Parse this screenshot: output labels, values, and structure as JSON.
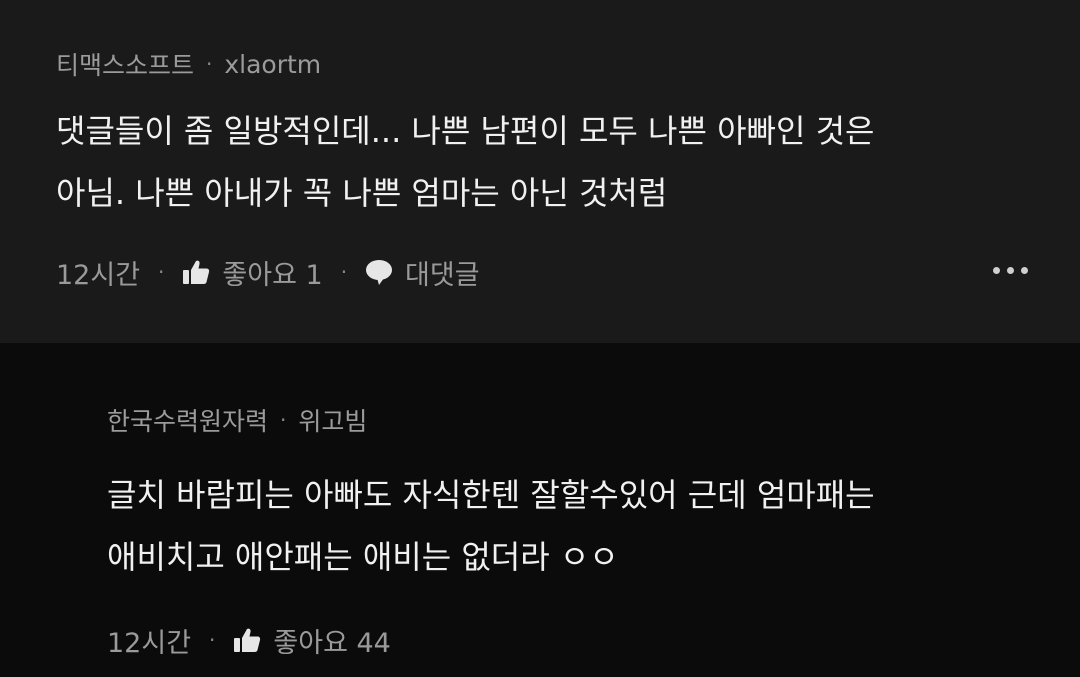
{
  "comments": [
    {
      "author": "티맥스소프트",
      "username": "xlaortm",
      "body_lines": [
        "댓글들이 좀 일방적인데... 나쁜 남편이 모두 나쁜 아빠인 것은",
        "아님. 나쁜 아내가 꼭 나쁜 엄마는 아닌 것처럼"
      ],
      "time": "12시간",
      "like_label": "좋아요 1",
      "reply_label": "대댓글"
    },
    {
      "author": "한국수력원자력",
      "username": "위고빔",
      "body_lines": [
        "글치 바람피는 아빠도 자식한텐 잘할수있어 근데 엄마패는",
        "애비치고 애안패는 애비는 없더라 ㅇㅇ"
      ],
      "time": "12시간",
      "like_label": "좋아요 44"
    }
  ],
  "separator": "·",
  "icons": {
    "like": "thumbs-up-icon",
    "reply": "speech-bubble-icon",
    "more": "more-horizontal-icon"
  },
  "colors": {
    "background_top": "#1a1a1a",
    "background_bottom": "#0b0b0b"
  }
}
